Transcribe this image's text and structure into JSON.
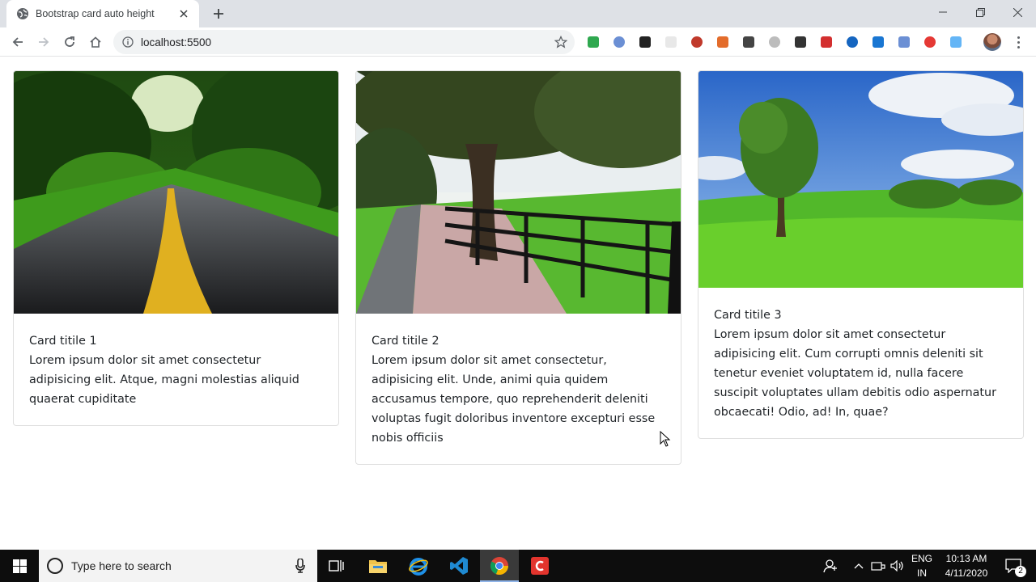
{
  "browser": {
    "tab_title": "Bootstrap card auto height",
    "url": "localhost:5500",
    "extensions": [
      "cors-extension-icon",
      "globe-extension-icon",
      "pen-extension-icon",
      "blank-extension-icon",
      "a-extension-icon",
      "color-picker-extension-icon",
      "circle-extension-icon",
      "puzzle-extension-icon",
      "moon-extension-icon",
      "red-square-extension-icon",
      "chart-extension-icon",
      "grid-extension-icon",
      "globe2-extension-icon",
      "shield-extension-icon",
      "info-extension-icon"
    ],
    "extension_colors": [
      "#2fa84f",
      "#6b8fd4",
      "#222222",
      "#e8e8e8",
      "#c0392b",
      "#e36c2b",
      "#444444",
      "#bcbcbc",
      "#333333",
      "#d32f2f",
      "#1565c0",
      "#1976d2",
      "#6b8fd4",
      "#e53935",
      "#64b5f6"
    ]
  },
  "cards": [
    {
      "title": "Card titile 1",
      "text": "Lorem ipsum dolor sit amet consectetur adipisicing elit. Atque, magni molestias aliquid quaerat cupiditate"
    },
    {
      "title": "Card titile 2",
      "text": "Lorem ipsum dolor sit amet consectetur, adipisicing elit. Unde, animi quia quidem accusamus tempore, quo reprehenderit deleniti voluptas fugit doloribus inventore excepturi esse nobis officiis"
    },
    {
      "title": "Card titile 3",
      "text": "Lorem ipsum dolor sit amet consectetur adipisicing elit. Cum corrupti omnis deleniti sit tenetur eveniet voluptatem id, nulla facere suscipit voluptates ullam debitis odio aspernatur obcaecati! Odio, ad! In, quae?"
    }
  ],
  "taskbar": {
    "search_placeholder": "Type here to search",
    "lang_line1": "ENG",
    "lang_line2": "IN",
    "time": "10:13 AM",
    "date": "4/11/2020",
    "notification_count": "2"
  }
}
